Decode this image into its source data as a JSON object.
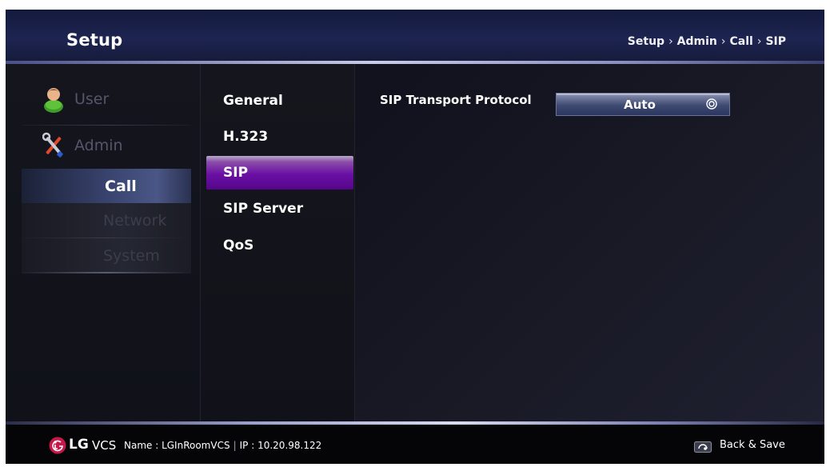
{
  "header": {
    "title": "Setup",
    "breadcrumb": [
      "Setup",
      "Admin",
      "Call",
      "SIP"
    ],
    "separator": "›"
  },
  "left_menu": {
    "user": "User",
    "admin": "Admin",
    "sub_items": [
      {
        "label": "Call",
        "state": "active"
      },
      {
        "label": "Network",
        "state": "dim"
      },
      {
        "label": "System",
        "state": "dim"
      }
    ]
  },
  "middle_menu": {
    "items": [
      {
        "label": "General",
        "state": "normal"
      },
      {
        "label": "H.323",
        "state": "normal"
      },
      {
        "label": "SIP",
        "state": "selected"
      },
      {
        "label": "SIP Server",
        "state": "normal"
      },
      {
        "label": "QoS",
        "state": "normal"
      }
    ]
  },
  "settings": {
    "sip_transport_protocol": {
      "label": "SIP Transport Protocol",
      "value": "Auto"
    }
  },
  "footer": {
    "brand": "LG",
    "product": "VCS",
    "name_text": "Name : LGInRoomVCS",
    "divider": "|",
    "ip_text": "IP : 10.20.98.122",
    "back_save": "Back & Save"
  },
  "colors": {
    "selection_purple": "#6a0fa4",
    "active_blue": "#38436d",
    "lg_red": "#c8174a"
  }
}
